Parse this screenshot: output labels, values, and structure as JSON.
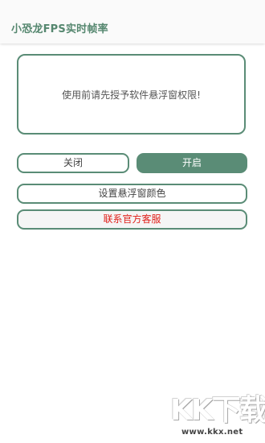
{
  "app": {
    "title": "小恐龙FPS实时帧率"
  },
  "notice": {
    "text": "使用前请先授予软件悬浮窗权限!"
  },
  "buttons": {
    "close_label": "关闭",
    "open_label": "开启",
    "float_color_label": "设置悬浮窗颜色",
    "contact_service_label": "联系官方客服"
  },
  "watermark": {
    "logo_text": "KK下载",
    "url_text": "www.kkx.net"
  },
  "colors": {
    "accent": "#5a8c76",
    "title_text": "#55876f",
    "service_text": "#e0201a"
  }
}
